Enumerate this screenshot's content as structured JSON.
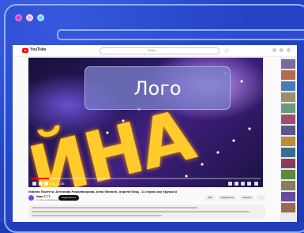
{
  "window": {
    "dots": [
      "window-dot-red",
      "window-dot-pink",
      "window-dot-blue"
    ]
  },
  "youtube": {
    "logo_text": "YouTube",
    "search_placeholder": "Поиск",
    "video_big_text": "ЙНА",
    "current_time": "0:00 / 12:35",
    "progress": 0.08,
    "title": "Извини Полетти, Антонова Рожаевкорова, Анна Фломен, Апрели Юнд - 11 серия шоу Кружок 8",
    "channel_name": "Иван Т.Т.Т.",
    "channel_subscribers": "1,2 млн подписчиков",
    "subscribe_label": "Подписаться",
    "actions": [
      "12K",
      "Поделиться",
      "Скачать",
      "..."
    ]
  },
  "overlay": {
    "label": "Лого"
  },
  "colors": {
    "background": "#2342c4",
    "frame_border": "#8fb0ff",
    "overlay_bg": "#7f84c8",
    "video_text": "#ffcb2b",
    "brand_red": "#ff0000"
  }
}
